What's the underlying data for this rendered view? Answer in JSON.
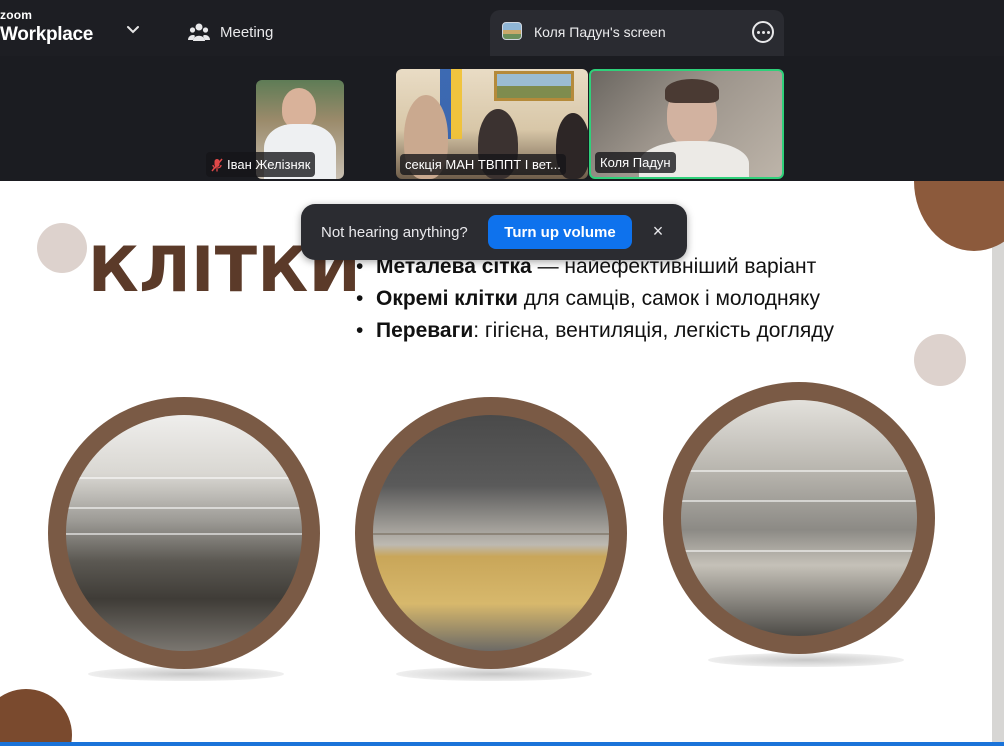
{
  "app": {
    "brand_line1": "zoom",
    "brand_line2": "Workplace"
  },
  "tabs": {
    "meeting_label": "Meeting",
    "screen_label": "Коля Падун's screen"
  },
  "participants": [
    {
      "name": "Іван Желізняк",
      "muted": true
    },
    {
      "name": "секція МАН ТВППТ І вет..."
    },
    {
      "name": "Коля Падун",
      "active_speaker": true
    }
  ],
  "slide": {
    "title": "КЛІТКИ",
    "bullets": [
      {
        "bold": "Металева сітка",
        "rest": " — найефективніший варіант"
      },
      {
        "bold": "Окремі клітки",
        "rest": " для самців, самок і молодняку"
      },
      {
        "bold": "Переваги",
        "rest": ": гігієна, вентиляція, легкість догляду"
      }
    ],
    "colors": {
      "title": "#5b3a29",
      "accent_brown": "#8c5a3c",
      "accent_beige": "#ddd2cd"
    }
  },
  "toast": {
    "message": "Not hearing anything?",
    "button_label": "Turn up volume",
    "close_glyph": "×"
  },
  "colors": {
    "active_speaker_border": "#2fd07a",
    "primary_button": "#0e72ed"
  },
  "icons": [
    "chevron-down-icon",
    "participants-icon",
    "more-icon",
    "mic-muted-icon",
    "close-icon"
  ]
}
